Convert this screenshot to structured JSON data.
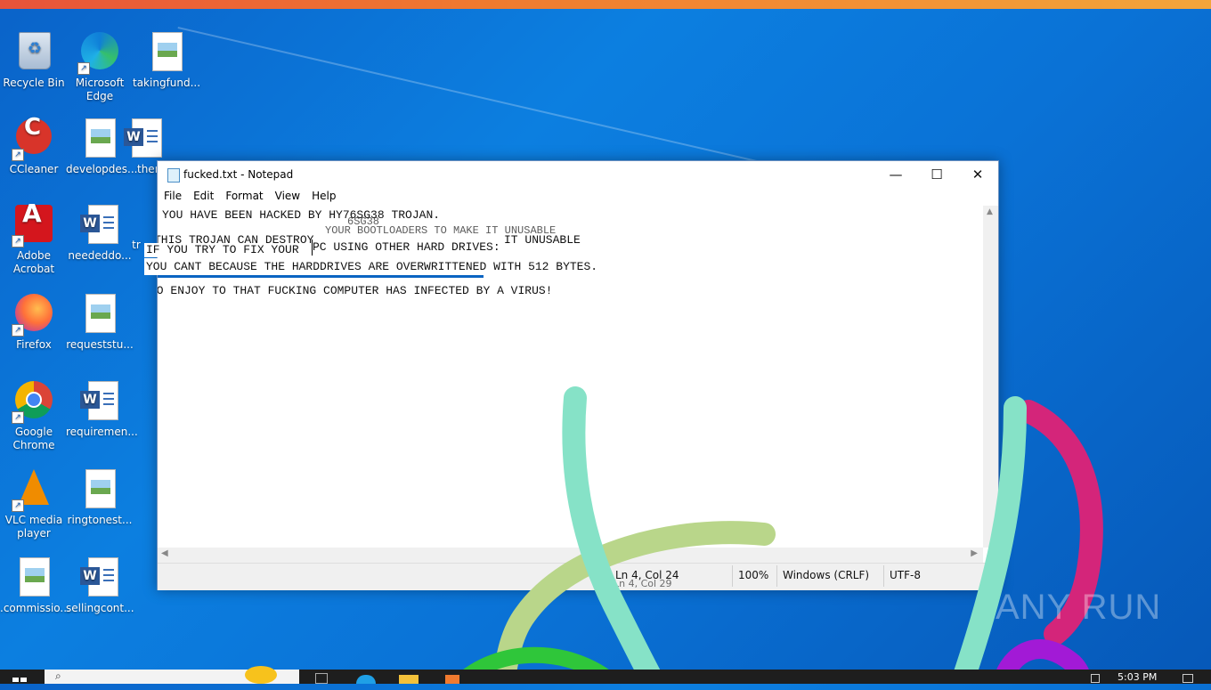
{
  "desktop_icons": [
    {
      "label": "Recycle Bin",
      "icon": "recycle-bin-icon"
    },
    {
      "label": "Microsoft Edge",
      "icon": "edge-icon"
    },
    {
      "label": "takingfund...",
      "icon": "image-file-icon"
    },
    {
      "label": "CCleaner",
      "icon": "ccleaner-icon"
    },
    {
      "label": "developdes...",
      "icon": "image-file-icon"
    },
    {
      "label": "ther",
      "icon": "word-doc-icon"
    },
    {
      "label": "Adobe Acrobat",
      "icon": "acrobat-icon"
    },
    {
      "label": "neededdo...",
      "icon": "word-doc-icon"
    },
    {
      "label": "tr",
      "icon": "image-file-icon"
    },
    {
      "label": "Firefox",
      "icon": "firefox-icon"
    },
    {
      "label": "requeststu...",
      "icon": "image-file-icon"
    },
    {
      "label": "Google Chrome",
      "icon": "chrome-icon"
    },
    {
      "label": "requiremen...",
      "icon": "word-doc-icon"
    },
    {
      "label": "VLC media player",
      "icon": "vlc-icon"
    },
    {
      "label": "ringtonest...",
      "icon": "image-file-icon"
    },
    {
      "label": ".commissio...",
      "icon": "image-file-icon"
    },
    {
      "label": "sellingcont...",
      "icon": "word-doc-icon"
    }
  ],
  "notepad": {
    "title": "fucked.txt - Notepad",
    "menu": [
      "File",
      "Edit",
      "Format",
      "View",
      "Help"
    ],
    "lines": {
      "line1": "YOU HAVE BEEN HACKED BY HY76SG38 TROJAN.",
      "ghost1": "6SG38",
      "ghost2": "YOUR BOOTLOADERS TO MAKE IT UNUSABLE",
      "line2": "THIS TROJAN CAN DESTROY",
      "ghost3": "IT UNUSABLE",
      "line4": "SO ENJOY TO THAT FUCKING COMPUTER HAS INFECTED BY A VIRUS!"
    },
    "glitch": {
      "fix_line": "IF YOU TRY TO FIX YOUR ",
      "fix_line_tail": "PC USING OTHER HARD DRIVES:",
      "cant_line": "YOU CANT BECAUSE THE HARDDRIVES ARE OVERWRITTENED WITH 512 BYTES."
    },
    "status": {
      "position": "Ln 4, Col 24",
      "position_ghost": "Ln 4, Col 29",
      "zoom": "100%",
      "line_ending": "Windows (CRLF)",
      "encoding": "UTF-8"
    }
  },
  "taskbar": {
    "time": "5:03 PM"
  },
  "watermark": "ANY RUN",
  "colors": {
    "desktop": "#0c7fe0",
    "selection": "#0a64c2",
    "stroke_teal": "#86e2c7",
    "stroke_lime": "#b9d68a",
    "stroke_magenta": "#d4257a",
    "stroke_purple": "#a21ad6",
    "stroke_green": "#2fc63a"
  }
}
